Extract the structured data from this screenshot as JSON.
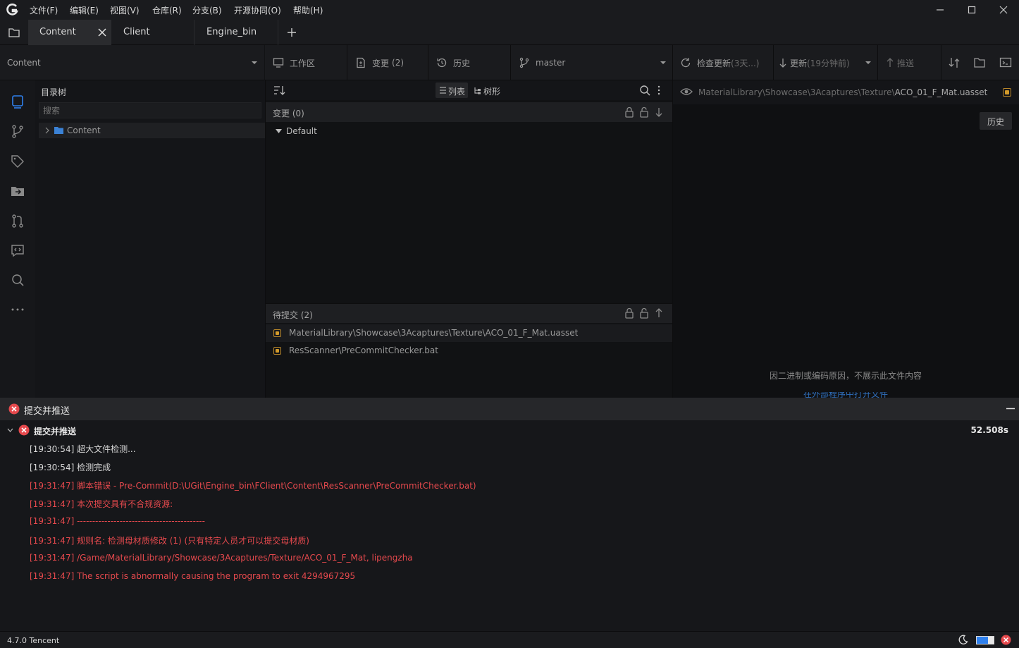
{
  "menu": [
    "文件(F)",
    "编辑(E)",
    "视图(V)",
    "仓库(R)",
    "分支(B)",
    "开源协同(O)",
    "帮助(H)"
  ],
  "tabs": [
    "Content",
    "Client",
    "Engine_bin"
  ],
  "repo_selector": "Content",
  "dirtree": {
    "title": "目录树",
    "search_placeholder": "搜索",
    "root": "Content"
  },
  "toolbar": {
    "workspace": "工作区",
    "changes": "变更",
    "changes_count": "(2)",
    "history": "历史",
    "branch": "master",
    "check_update": "检查更新",
    "check_update_meta": "(3天...)",
    "pull": "更新",
    "pull_meta": "(19分钟前)",
    "push": "推送"
  },
  "list_toolbar": {
    "list": "列表",
    "tree": "树形"
  },
  "changes_section": {
    "title": "变更 (0)",
    "group": "Default"
  },
  "staged_section": {
    "title": "待提交 (2)",
    "files": [
      "MaterialLibrary\\Showcase\\3Acaptures\\Texture\\ACO_01_F_Mat.uasset",
      "ResScanner\\PreCommitChecker.bat"
    ]
  },
  "preview": {
    "path_prefix": "MaterialLibrary\\Showcase\\3Acaptures\\Texture\\",
    "path_file": "ACO_01_F_Mat.uasset",
    "history_button": "历史",
    "message": "因二进制或编码原因，不展示此文件内容",
    "link": "在外部程序中打开文件"
  },
  "output": {
    "panel_title": "提交并推送",
    "task_title": "提交并推送",
    "duration": "52.508s",
    "logs": [
      {
        "text": "[19:30:54] 超大文件检测...",
        "level": "info"
      },
      {
        "text": "[19:30:54] 检测完成",
        "level": "info"
      },
      {
        "text": "[19:31:47] 脚本错误 - Pre-Commit(D:\\UGit\\Engine_bin\\FClient\\Content\\ResScanner\\PreCommitChecker.bat)",
        "level": "error"
      },
      {
        "text": "[19:31:47] 本次提交具有不合规资源:",
        "level": "error"
      },
      {
        "text": "[19:31:47] ------------------------------------------",
        "level": "error"
      },
      {
        "text": "[19:31:47] 规则名: 检测母材质修改 (1) (只有特定人员才可以提交母材质)",
        "level": "error"
      },
      {
        "text": "[19:31:47] /Game/MaterialLibrary/Showcase/3Acaptures/Texture/ACO_01_F_Mat, lipengzha",
        "level": "error"
      },
      {
        "text": "[19:31:47] The script is abnormally causing the program to exit 4294967295",
        "level": "error"
      }
    ]
  },
  "status": {
    "version": "4.7.0 Tencent"
  },
  "colors": {
    "error": "#e5494d",
    "accent": "#2f80ed",
    "badge": "#d39a2a"
  }
}
